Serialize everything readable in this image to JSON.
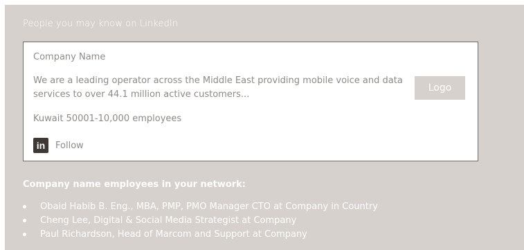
{
  "section_title": "People you may know on LinkedIn",
  "card": {
    "company_name": "Company Name",
    "description": "We are a leading operator across the Middle East providing mobile voice and data services to over 44.1 million active customers...",
    "meta": "Kuwait 50001-10,000 employees",
    "follow_icon_text": "in",
    "follow_label": "Follow",
    "logo_label": "Logo"
  },
  "network": {
    "title": "Company name employees in your network:",
    "people": [
      "Obaid Habib B. Eng., MBA, PMP, PMO Manager CTO at Company in Country",
      "Cheng Lee, Digital & Social Media Strategist at Company",
      "Paul Richardson, Head of Marcom and Support at Company"
    ]
  },
  "colors": {
    "panel_background": "#d6d1cd",
    "card_border": "#6f6b67",
    "muted_text": "#8f8a86",
    "linkedin_icon": "#3f3935"
  }
}
